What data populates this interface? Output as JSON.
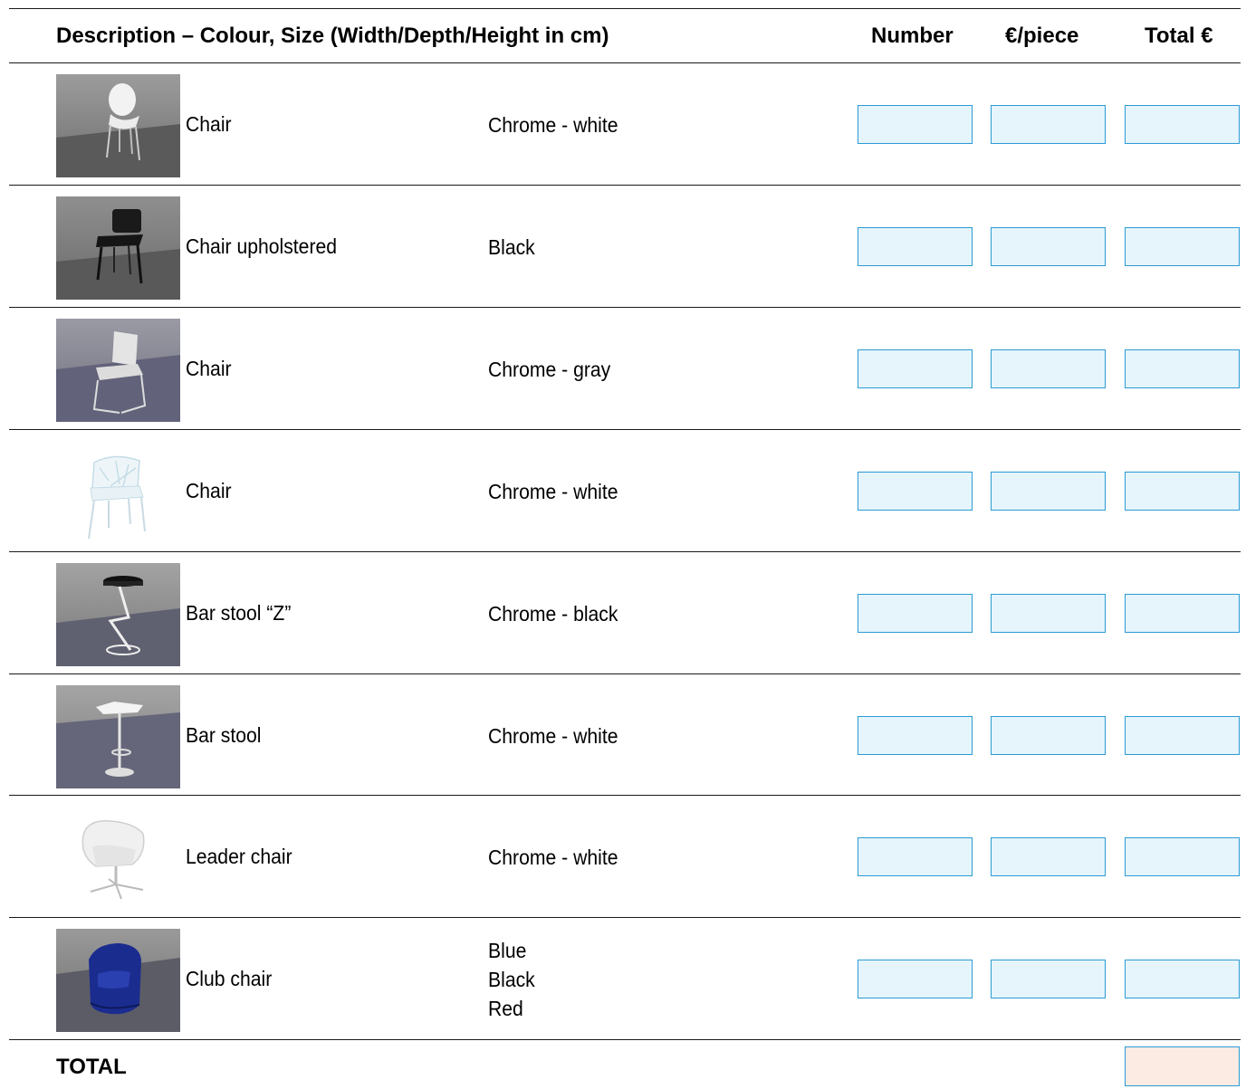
{
  "header": {
    "description": "Description – Colour, Size (Width/Depth/Height in cm)",
    "number": "Number",
    "price_per_piece": "€/piece",
    "total": "Total €"
  },
  "rows": [
    {
      "item": "Chair",
      "colours": [
        "Chrome - white"
      ],
      "image": "chair-white-shell-icon"
    },
    {
      "item": "Chair upholstered",
      "colours": [
        "Black"
      ],
      "image": "chair-black-upholstered-icon"
    },
    {
      "item": "Chair",
      "colours": [
        "Chrome - gray"
      ],
      "image": "chair-gray-stacking-icon"
    },
    {
      "item": "Chair",
      "colours": [
        "Chrome - white"
      ],
      "image": "chair-white-lattice-icon"
    },
    {
      "item": "Bar stool “Z”",
      "colours": [
        "Chrome - black"
      ],
      "image": "bar-stool-z-icon"
    },
    {
      "item": "Bar stool",
      "colours": [
        "Chrome - white"
      ],
      "image": "bar-stool-white-icon"
    },
    {
      "item": "Leader chair",
      "colours": [
        "Chrome - white"
      ],
      "image": "leader-chair-swan-icon"
    },
    {
      "item": "Club chair",
      "colours": [
        "Blue",
        "Black",
        "Red"
      ],
      "image": "club-chair-blue-icon"
    }
  ],
  "footer": {
    "total_label": "TOTAL"
  },
  "colors": {
    "field_fill": "#e6f4fb",
    "field_border": "#2a9bd4",
    "total_fill": "#fbebe3"
  }
}
